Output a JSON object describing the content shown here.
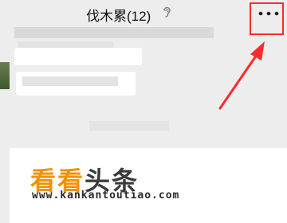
{
  "header": {
    "title": "伐木累(12)",
    "ear_icon": "ear-icon",
    "more_icon": "more-dots-icon"
  },
  "annotation": {
    "highlight_color": "#ff2a2a",
    "arrow_color": "#ff2a2a"
  },
  "watermark": {
    "brand_part1": "看看",
    "brand_part2": "头条",
    "url": "www.kankantoutiao.com",
    "accent_color": "#f29100"
  }
}
